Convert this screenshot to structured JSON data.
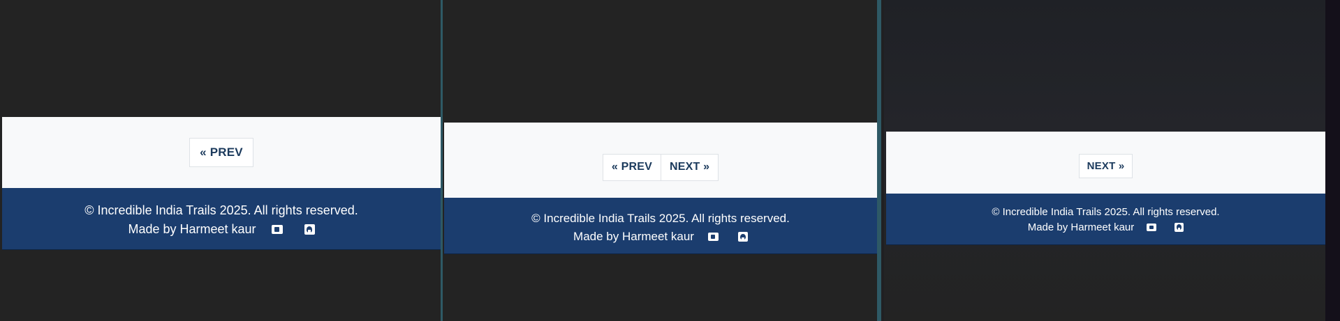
{
  "panels": [
    {
      "prev_label": "« PREV",
      "footer": {
        "copyright": "© Incredible India Trails 2025. All rights reserved.",
        "made_by": "Made by Harmeet kaur",
        "icons": [
          "youtube-icon",
          "github-icon"
        ]
      }
    },
    {
      "prev_label": "« PREV",
      "next_label": "NEXT »",
      "footer": {
        "copyright": "© Incredible India Trails 2025. All rights reserved.",
        "made_by": "Made by Harmeet kaur",
        "icons": [
          "youtube-icon",
          "github-icon"
        ]
      }
    },
    {
      "next_label": "NEXT »",
      "footer": {
        "copyright": "© Incredible India Trails 2025. All rights reserved.",
        "made_by": "Made by Harmeet kaur",
        "icons": [
          "youtube-icon",
          "github-icon"
        ]
      }
    }
  ],
  "colors": {
    "footer_bg": "#1b3d6e",
    "pager_bg": "#f8f9fa",
    "button_text": "#1b3a5c",
    "page_bg": "#232323"
  }
}
